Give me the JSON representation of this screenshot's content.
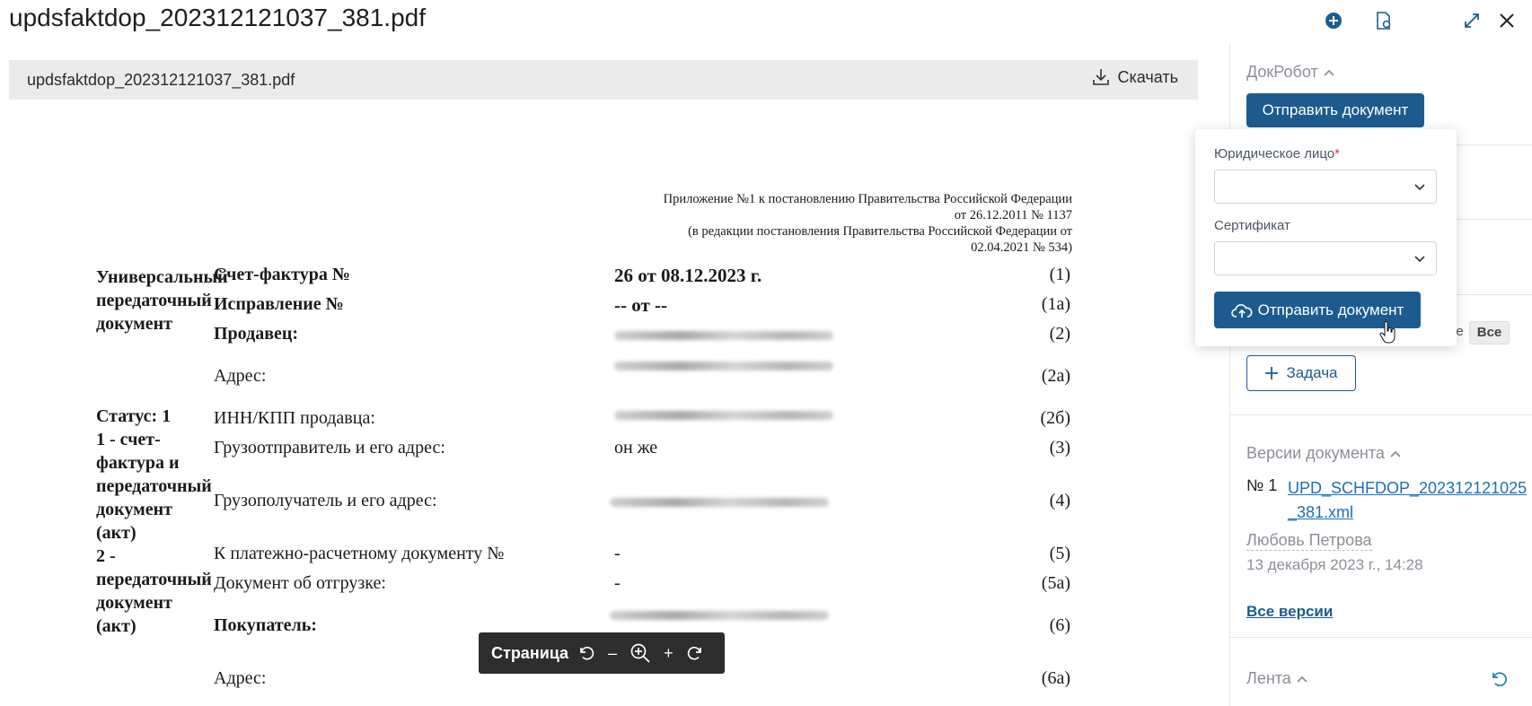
{
  "window": {
    "title": "updsfaktdop_202312121037_381.pdf",
    "icons": [
      "add-circle-icon",
      "document-settings-icon",
      "expand-icon",
      "close-icon"
    ]
  },
  "viewer": {
    "file_name": "updsfaktdop_202312121037_381.pdf",
    "download_label": "Скачать",
    "pager": {
      "label": "Страница",
      "minus": "–",
      "plus": "+"
    }
  },
  "document": {
    "header_note": [
      "Приложение №1 к постановлению Правительства Российской Федерации",
      "от 26.12.2011 № 1137",
      "(в редакции постановления Правительства Российской Федерации от",
      "02.04.2021 № 534)"
    ],
    "left_title": "Универсальный передаточный документ",
    "left_status": "Статус: 1",
    "left_status_desc": "1 - счет-фактура и передаточный документ (акт)\n2 - передаточный документ (акт)",
    "rows": [
      {
        "label": "Счет-фактура №",
        "value": "26 от 08.12.2023 г.",
        "num": "(1)"
      },
      {
        "label": "Исправление №",
        "value": "-- от --",
        "num": "(1а)"
      },
      {
        "label": "Продавец:",
        "value": "",
        "num": "(2)"
      },
      {
        "label": "Адрес:",
        "value": "",
        "num": "(2а)"
      },
      {
        "label": "ИНН/КПП продавца:",
        "value": "",
        "num": "(2б)"
      },
      {
        "label": "Грузоотправитель и его адрес:",
        "value": "он же",
        "num": "(3)"
      },
      {
        "label": "Грузополучатель и его адрес:",
        "value": "",
        "num": "(4)"
      },
      {
        "label": "К платежно-расчетному документу №",
        "value": "-",
        "num": "(5)"
      },
      {
        "label": "Документ об отгрузке:",
        "value": "-",
        "num": "(5а)"
      },
      {
        "label": "Покупатель:",
        "value": "",
        "num": "(6)"
      },
      {
        "label": "Адрес:",
        "value": "",
        "num": "(6а)"
      }
    ]
  },
  "sidebar": {
    "docrobot": {
      "title": "ДокРобот",
      "send_button": "Отправить документ"
    },
    "popover": {
      "legal_entity_label": "Юридическое лицо",
      "required_mark": "*",
      "legal_entity_value": "",
      "certificate_label": "Сертификат",
      "certificate_value": "",
      "submit_label": "Отправить документ"
    },
    "filter": {
      "partial": "ие",
      "all": "Все"
    },
    "task_button": "Задача",
    "versions": {
      "title": "Версии документа",
      "number": "№ 1",
      "file_line1": "UPD_SCHFDOP_202312121025",
      "file_line2": "_381.xml",
      "author": "Любовь Петрова",
      "date": "13 декабря 2023 г., 14:28",
      "all_versions": "Все версии"
    },
    "feed": {
      "title": "Лента"
    }
  },
  "colors": {
    "accent": "#1d5b8f",
    "link": "#1d6fb4",
    "pager_bg": "#2d2d2d"
  }
}
